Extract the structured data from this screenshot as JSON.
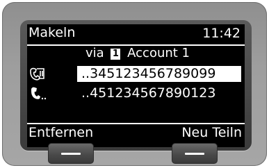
{
  "screen": {
    "title": "Makeln",
    "clock": "11:42",
    "via_prefix": "via",
    "account_badge": "1",
    "account_name": "Account 1",
    "calls": [
      {
        "icon": "held-call-icon",
        "number": "..345123456789099",
        "selected": true
      },
      {
        "icon": "active-call-icon",
        "number": "..451234567890123",
        "selected": false
      }
    ],
    "softkeys": {
      "left": "Entfernen",
      "right": "Neu Teiln"
    }
  },
  "colors": {
    "screen_bg": "#000000",
    "screen_fg": "#ffffff",
    "device_body": "#9e9e9e",
    "bezel": "#4a4a4a"
  }
}
